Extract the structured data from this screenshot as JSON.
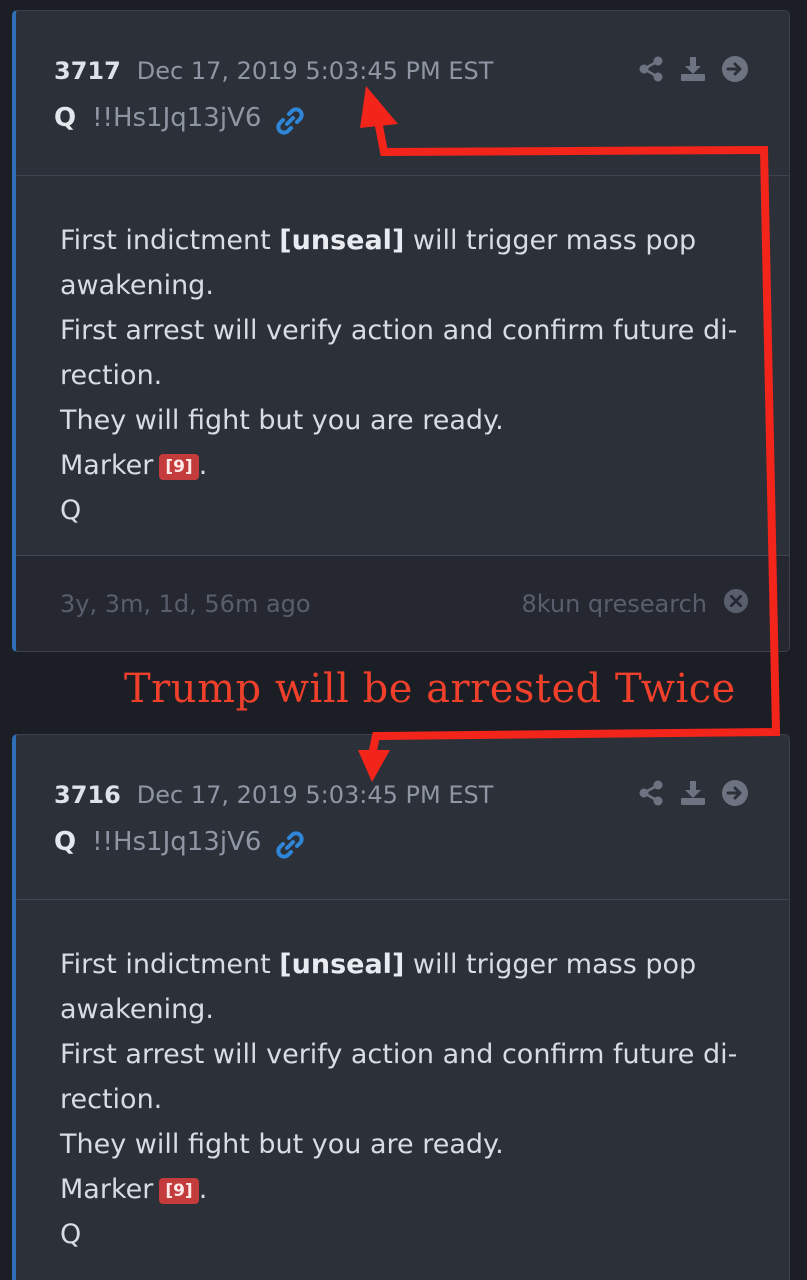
{
  "posts": [
    {
      "number": "3717",
      "date": "Dec 17, 2019 5:03:45 PM EST",
      "author": "Q",
      "tripcode": "!!Hs1Jq13jV6",
      "lines": {
        "l1_pre": "First indictment ",
        "l1_bold": "[unseal]",
        "l1_post": " will trigger mass pop",
        "l2": "awakening.",
        "l3": "First arrest will verify action and confirm future di-",
        "l4": "rection.",
        "l5": "They will fight but you are ready.",
        "l6_pre": "Marker",
        "l6_badge": "[9]",
        "l6_post": ".",
        "l7": "Q"
      },
      "age": "3y, 3m, 1d, 56m ago",
      "source": "8kun qresearch"
    },
    {
      "number": "3716",
      "date": "Dec 17, 2019 5:03:45 PM EST",
      "author": "Q",
      "tripcode": "!!Hs1Jq13jV6",
      "lines": {
        "l1_pre": "First indictment ",
        "l1_bold": "[unseal]",
        "l1_post": " will trigger mass pop",
        "l2": "awakening.",
        "l3": "First arrest will verify action and confirm future di-",
        "l4": "rection.",
        "l5": "They will fight but you are ready.",
        "l6_pre": "Marker",
        "l6_badge": "[9]",
        "l6_post": ".",
        "l7": "Q"
      }
    }
  ],
  "annotation": {
    "text": "Trump will be arrested Twice",
    "color": "#f0402c"
  },
  "icons": [
    "share-icon",
    "download-icon",
    "arrow-right-circle-icon",
    "link-icon",
    "close-circle-icon"
  ],
  "colors": {
    "accent": "#2f6fb6",
    "badge": "#c33b3b",
    "background": "#2c3039"
  }
}
